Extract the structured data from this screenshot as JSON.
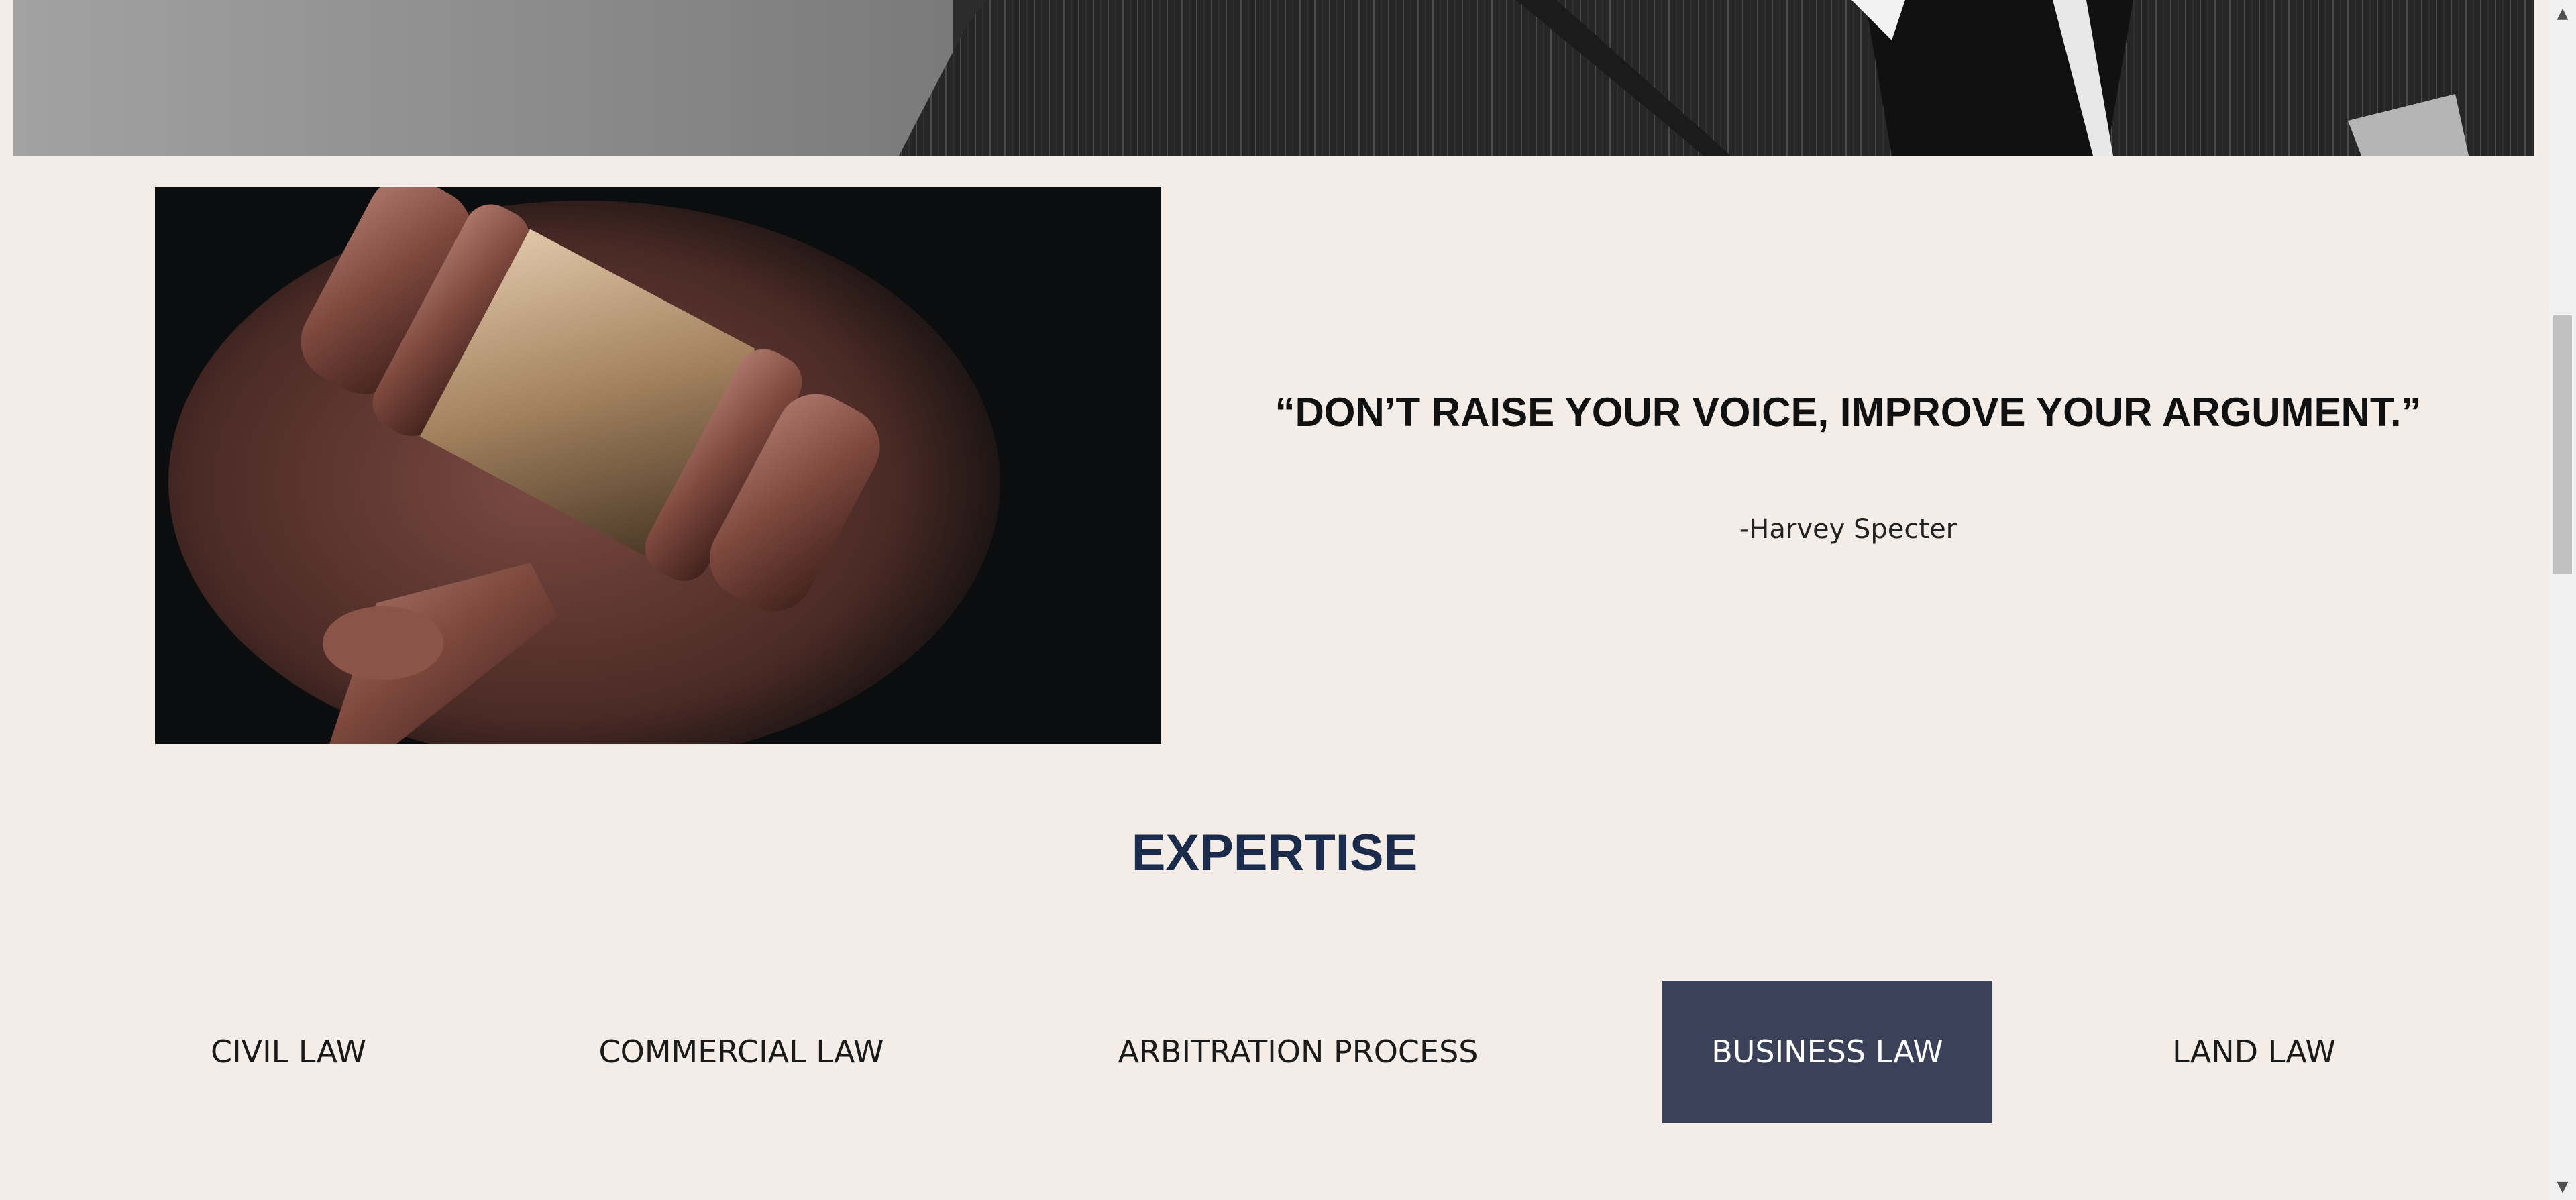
{
  "quote": {
    "text": "“DON’T RAISE YOUR VOICE, IMPROVE YOUR ARGUMENT.”",
    "author": "-Harvey Specter"
  },
  "expertise": {
    "title": "EXPERTISE",
    "tabs": [
      {
        "label": "CIVIL LAW",
        "active": false
      },
      {
        "label": "COMMERCIAL LAW",
        "active": false
      },
      {
        "label": "ARBITRATION PROCESS",
        "active": false
      },
      {
        "label": "BUSINESS LAW",
        "active": true
      },
      {
        "label": "LAND LAW",
        "active": false
      }
    ]
  },
  "colors": {
    "page_background": "#f4ede7",
    "heading": "#1b2b4b",
    "active_tab": "#3a4159"
  },
  "scrollbar": {
    "up_icon": "scroll-up-arrow-icon",
    "down_icon": "scroll-down-arrow-icon"
  }
}
